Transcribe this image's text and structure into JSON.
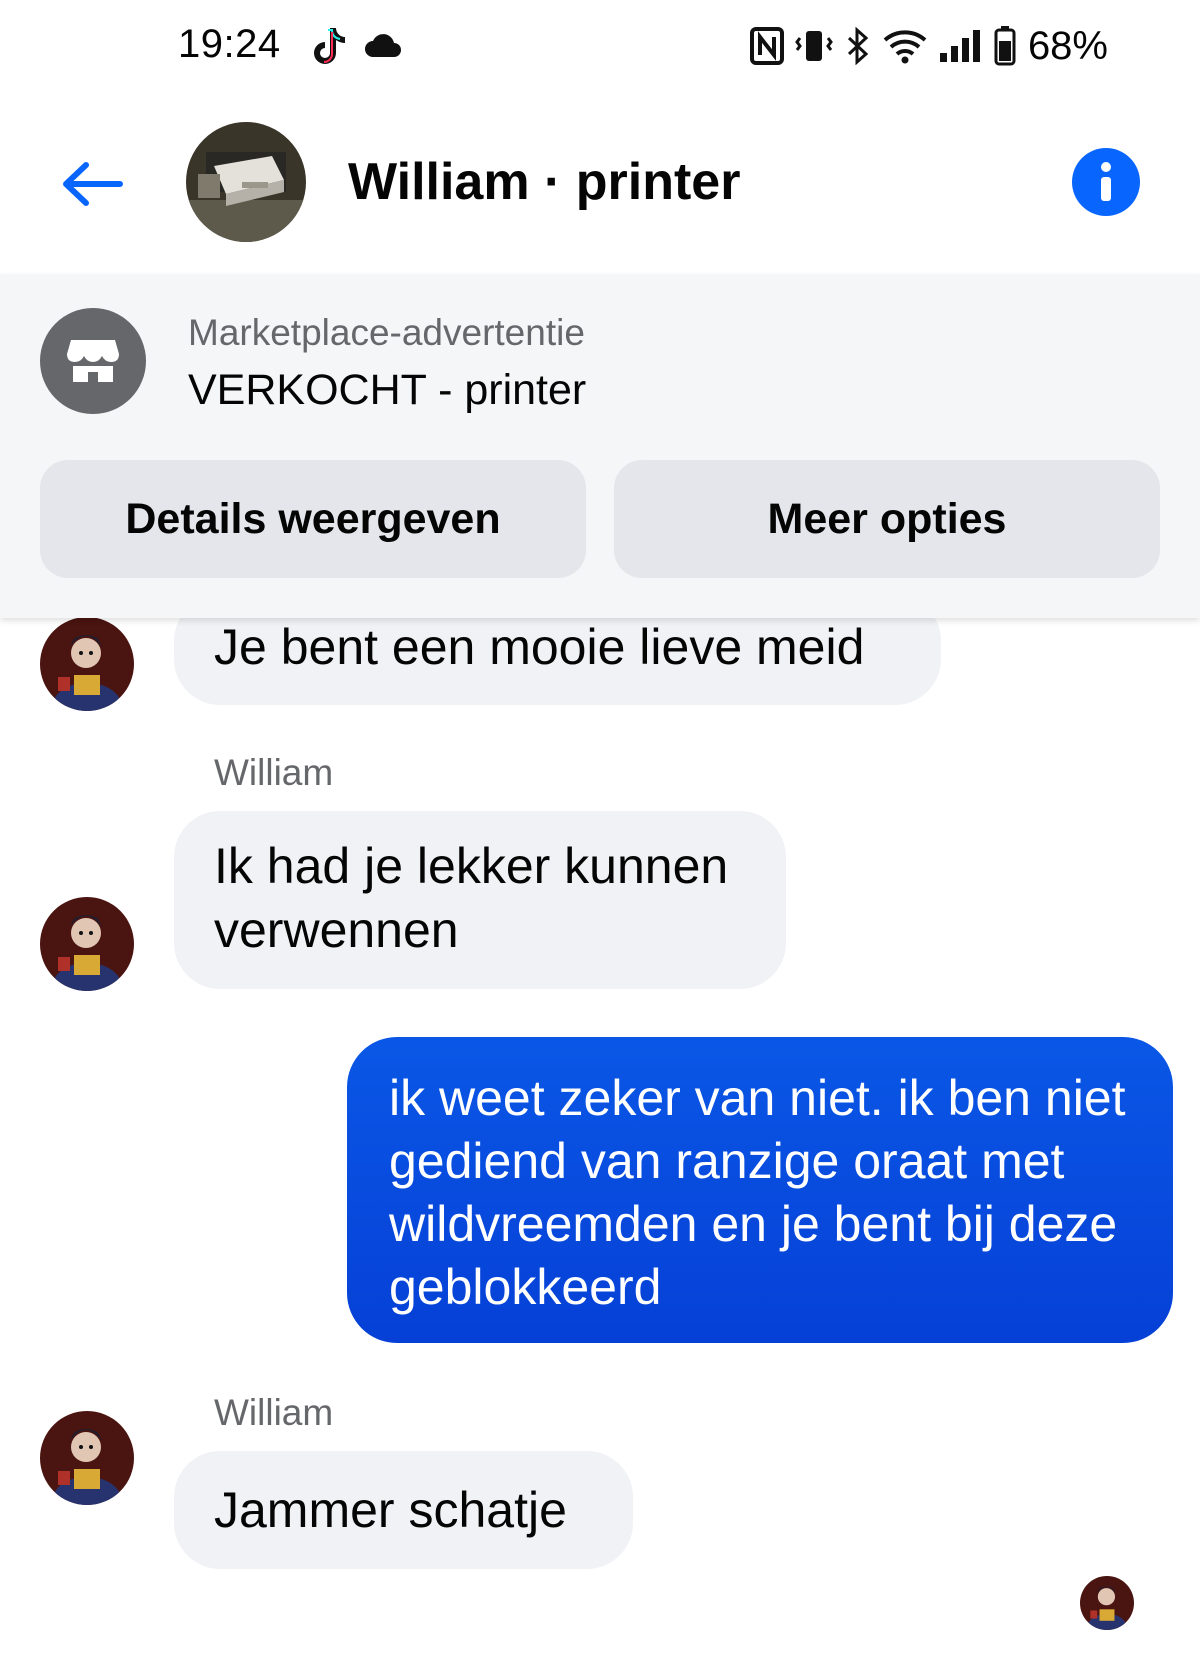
{
  "status_bar": {
    "time": "19:24",
    "battery": "68%",
    "icons": [
      "tiktok-icon",
      "cloud-icon",
      "nfc-icon",
      "vibrate-icon",
      "bluetooth-icon",
      "wifi-icon",
      "signal-icon",
      "battery-icon"
    ]
  },
  "header": {
    "title": "William · printer",
    "icons": [
      "back-arrow-icon",
      "info-icon"
    ]
  },
  "marketplace": {
    "subtitle": "Marketplace-advertentie",
    "title": "VERKOCHT - printer",
    "details_label": "Details weergeven",
    "more_label": "Meer opties",
    "icon": "storefront-icon"
  },
  "messages": [
    {
      "direction": "incoming",
      "text": "Je bent een mooie lieve meid"
    },
    {
      "direction": "incoming",
      "sender": "William",
      "text": "Ik had je lekker kunnen verwennen"
    },
    {
      "direction": "outgoing",
      "text": "ik weet zeker van niet. ik ben niet gediend van ranzige oraat met wildvreemden en je bent bij deze geblokkeerd"
    },
    {
      "direction": "incoming",
      "sender": "William",
      "text": "Jammer schatje"
    }
  ],
  "colors": {
    "accent": "#0866ff",
    "outgoing_bubble": "#0a4fe0",
    "incoming_bubble": "#f0f2f5",
    "panel_bg": "#f5f6f7",
    "button_bg": "#e4e6eb",
    "secondary_text": "#65676b"
  }
}
